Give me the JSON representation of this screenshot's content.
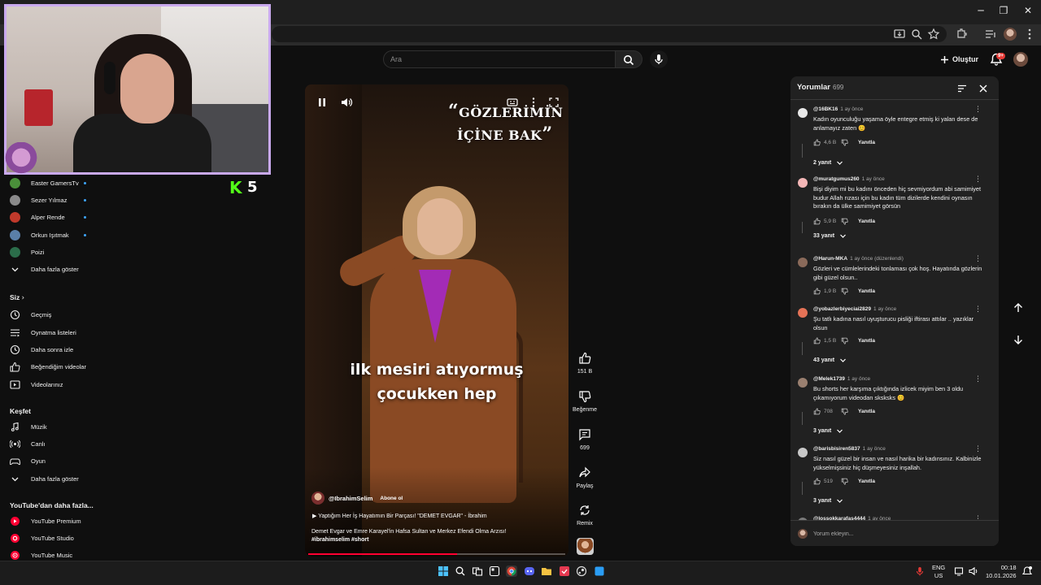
{
  "header": {
    "search_placeholder": "Ara",
    "create_label": "Oluştur",
    "notification_badge": "9+"
  },
  "sidebar": {
    "subscriptions": [
      {
        "name": "Easter GamersTv",
        "color": "#4a8f3a",
        "live_dot": true
      },
      {
        "name": "Sezer Yılmaz",
        "color": "#8a8a8a",
        "live_dot": true
      },
      {
        "name": "Alper Rende",
        "color": "#c0392b",
        "live_dot": true
      },
      {
        "name": "Orkun Işıtmak",
        "color": "#5a7fa8",
        "live_dot": true
      },
      {
        "name": "Poizi",
        "color": "#2b6d4a",
        "live_dot": false
      }
    ],
    "show_more_1": "Daha fazla göster",
    "you_heading": "Siz",
    "you_items": [
      {
        "label": "Geçmiş",
        "icon": "history-icon"
      },
      {
        "label": "Oynatma listeleri",
        "icon": "playlists-icon"
      },
      {
        "label": "Daha sonra izle",
        "icon": "watch-later-icon"
      },
      {
        "label": "Beğendiğim videolar",
        "icon": "liked-icon"
      },
      {
        "label": "Videolarınız",
        "icon": "your-videos-icon"
      }
    ],
    "explore_heading": "Keşfet",
    "explore_items": [
      {
        "label": "Müzik",
        "icon": "music-icon"
      },
      {
        "label": "Canlı",
        "icon": "live-icon"
      },
      {
        "label": "Oyun",
        "icon": "gaming-icon"
      }
    ],
    "show_more_2": "Daha fazla göster",
    "more_heading": "YouTube'dan daha fazla...",
    "more_items": [
      {
        "label": "YouTube Premium"
      },
      {
        "label": "YouTube Studio"
      },
      {
        "label": "YouTube Music"
      }
    ]
  },
  "kick_overlay": {
    "count": "5"
  },
  "video": {
    "title_line1": "GÖZLERİMİN",
    "title_line2": "İÇİNE BAK",
    "subtitle_line1": "ilk mesiri atıyormuş",
    "subtitle_line2": "çocukken hep",
    "channel": "@IbrahimSelim",
    "subscribe_label": "Abone ol",
    "playlist": "Yaptığım Her İş Hayatımın Bir Parçası! \"DEMET EVGAR\" - İbrahim",
    "description": "Demet Evgar ve Emre Karayel'in Hafsa Sultan ve Merkez Efendi Olma Arzısı!",
    "hashtags": "#ibrahimselim #short",
    "progress": 0.58
  },
  "actions": {
    "likes": "151 B",
    "dislike_label": "Beğenme",
    "comments": "699",
    "share_label": "Paylaş",
    "remix_label": "Remix"
  },
  "comments": {
    "title": "Yorumlar",
    "count": "699",
    "items": [
      {
        "user": "@16BK16",
        "time": "1 ay önce",
        "text": "Kadın oyunculuğu yaşama öyle entegre etmiş ki yalan dese de anlamayız zaten 😊",
        "likes": "4,6 B",
        "reply_label": "Yanıtla",
        "replies": "2 yanıt",
        "avatar_color": "#e8e8e8"
      },
      {
        "user": "@muratgumus260",
        "time": "1 ay önce",
        "text": "Bişi diyim mi bu kadını önceden hiç sevmiyordum abi samimiyet budur Allah rızası için bu kadın tüm dizilerde kendini oynasın bırakın da ülke samimiyet görsün",
        "likes": "5,9 B",
        "reply_label": "Yanıtla",
        "replies": "33 yanıt",
        "avatar_color": "#f4b7b7"
      },
      {
        "user": "@Harun-MKA",
        "time": "1 ay önce (düzenlendi)",
        "text": "Gözleri ve cümlelerindeki tonlaması çok hoş. Hayatında gözlerin gibi güzel olsun..",
        "likes": "1,9 B",
        "reply_label": "Yanıtla",
        "replies": "",
        "avatar_color": "#8a6a5a"
      },
      {
        "user": "@yobazlerbiyeciai2829",
        "time": "1 ay önce",
        "text": "Şu tatlı kadına nasıl uyuşturucu pisliği iftirası attılar .. yazıklar olsun",
        "likes": "1,5 B",
        "reply_label": "Yanıtla",
        "replies": "43 yanıt",
        "avatar_color": "#e57357"
      },
      {
        "user": "@Melek1739",
        "time": "1 ay önce",
        "text": "Bu shorts her karşıma çıktığında izlicek miyim ben 3 oldu çıkamıyorum videodan sksksks 😊",
        "likes": "708",
        "reply_label": "Yanıtla",
        "replies": "3 yanıt",
        "avatar_color": "#9a8070"
      },
      {
        "user": "@barisbisiren5837",
        "time": "1 ay önce",
        "text": "Siz nasıl güzel bir insan ve nasıl harika bir kadınsınız. Kalbinizle yükselmişsiniz hiç düşmeyesiniz inşallah.",
        "likes": "519",
        "reply_label": "Yanıtla",
        "replies": "3 yanıt",
        "avatar_color": "#c8c8c8"
      },
      {
        "user": "@lossokkarafas4444",
        "time": "1 ay önce",
        "text": "",
        "likes": "",
        "reply_label": "",
        "replies": "",
        "avatar_color": "#7a7a7a"
      }
    ],
    "input_placeholder": "Yorum ekleyin..."
  },
  "taskbar": {
    "lang_line1": "ENG",
    "lang_line2": "US",
    "time": "00:18",
    "date": "10.01.2026"
  }
}
